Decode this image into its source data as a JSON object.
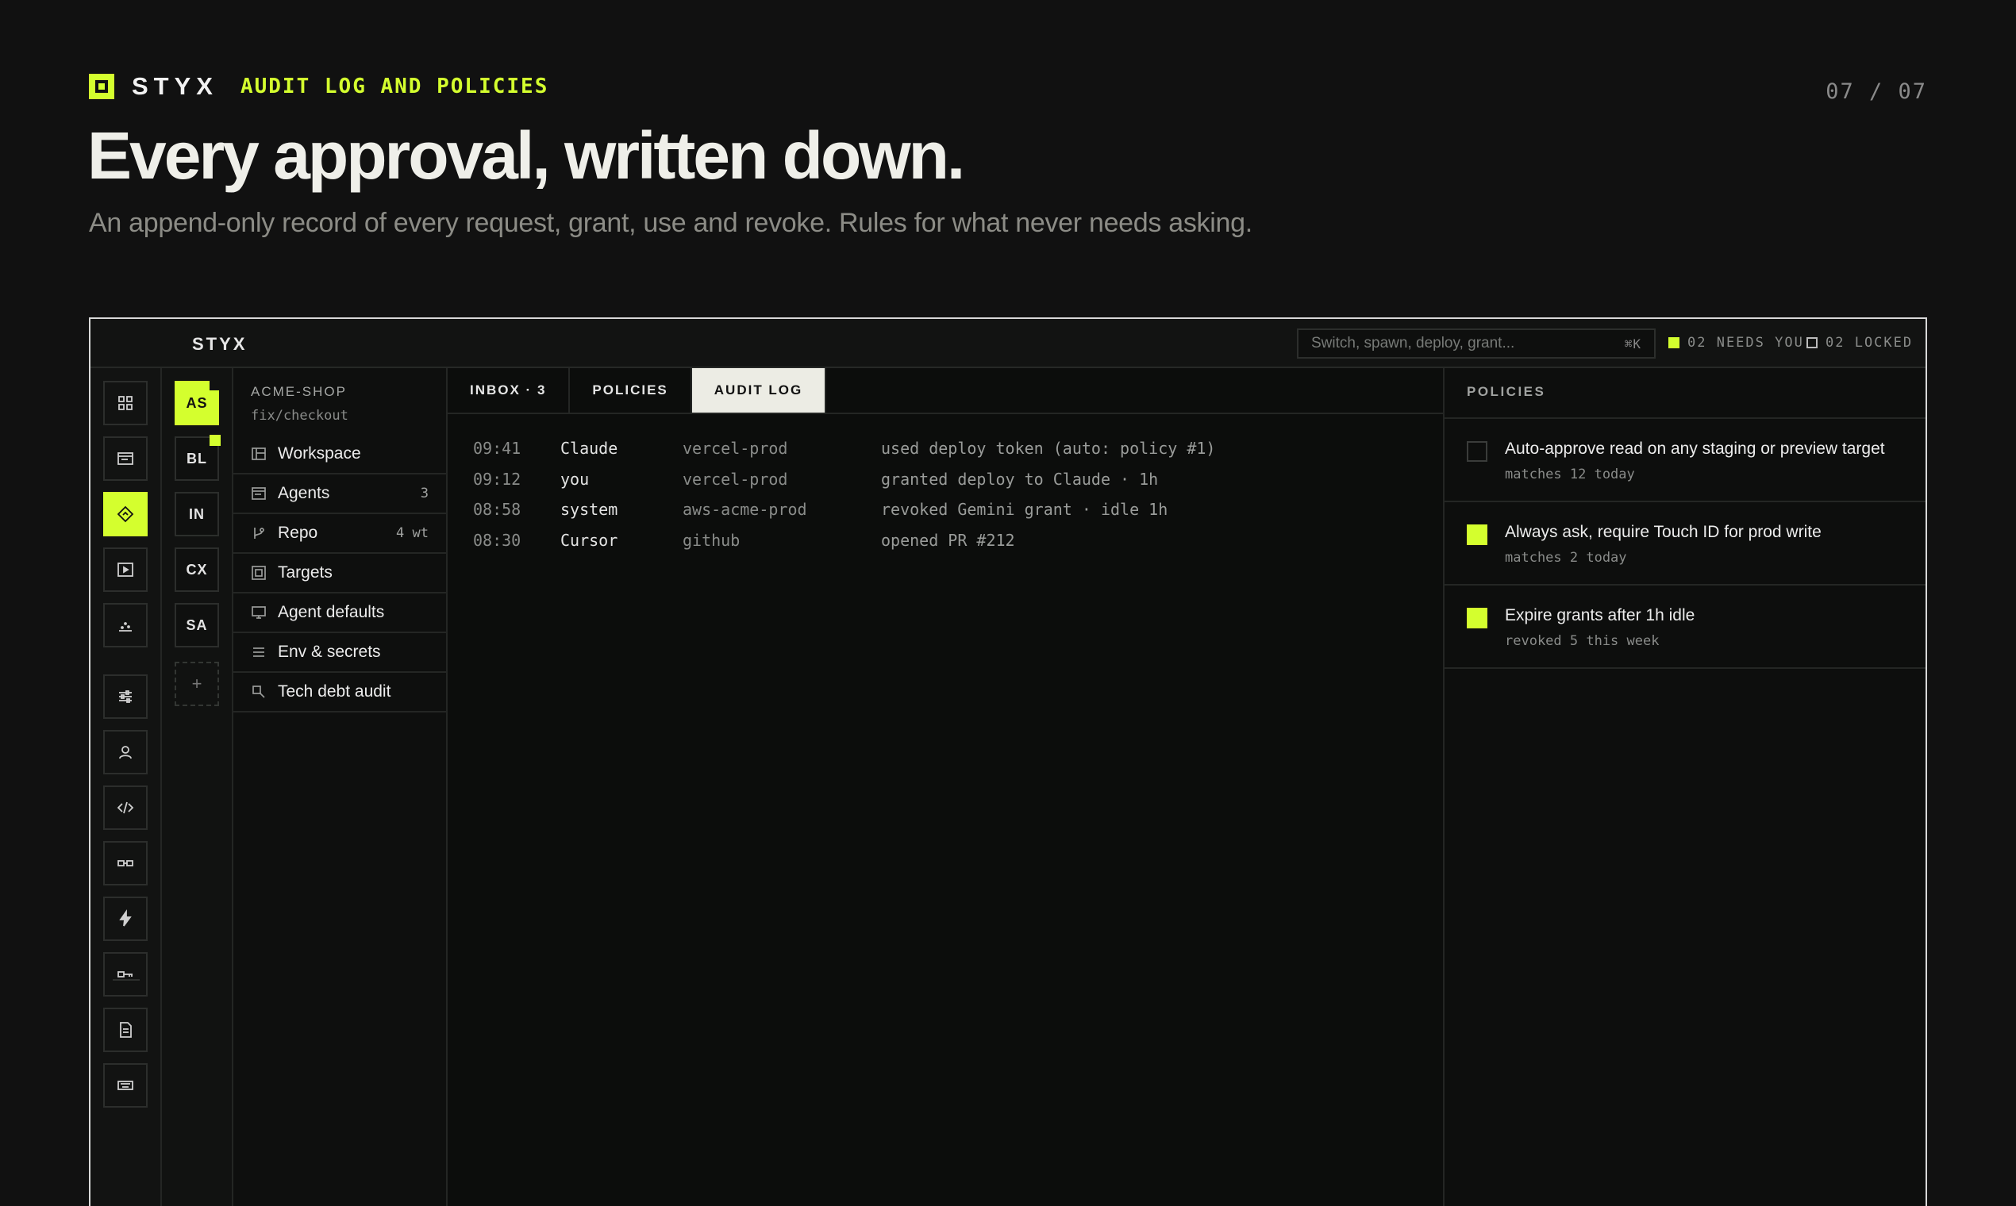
{
  "slide": {
    "brand": "STYX",
    "section": "AUDIT LOG AND POLICIES",
    "page": "07 / 07",
    "headline": "Every approval, written down.",
    "subhead": "An append-only record of every request, grant, use and revoke. Rules for what never needs asking."
  },
  "colors": {
    "accent": "#d4ff2e",
    "background": "#111111"
  },
  "app": {
    "title": "STYX",
    "search": {
      "placeholder": "Switch, spawn, deploy, grant...",
      "shortcut": "⌘K"
    },
    "status": {
      "needs_you": "02 NEEDS YOU",
      "locked": "02 LOCKED"
    },
    "rail": [
      {
        "icon": "grid-icon"
      },
      {
        "icon": "browser-window-icon"
      },
      {
        "icon": "diamond-route-icon",
        "active": true
      },
      {
        "icon": "play-icon"
      },
      {
        "icon": "chart-icon"
      },
      {
        "icon": "sliders-icon"
      },
      {
        "icon": "user-icon"
      },
      {
        "icon": "code-icon"
      },
      {
        "icon": "link-icon"
      },
      {
        "icon": "bolt-icon"
      },
      {
        "icon": "key-icon"
      },
      {
        "icon": "document-icon"
      },
      {
        "icon": "keyboard-icon"
      }
    ],
    "projects": [
      {
        "label": "AS",
        "active": true
      },
      {
        "label": "BL",
        "badge": true
      },
      {
        "label": "IN"
      },
      {
        "label": "CX"
      },
      {
        "label": "SA"
      }
    ],
    "project_add": "+",
    "nav": {
      "org": "ACME-SHOP",
      "branch": "fix/checkout",
      "items": [
        {
          "label": "Workspace",
          "count": "",
          "icon": "layout-icon"
        },
        {
          "label": "Agents",
          "count": "3",
          "icon": "browser-window-icon"
        },
        {
          "label": "Repo",
          "count": "4 wt",
          "icon": "git-branch-icon"
        },
        {
          "label": "Targets",
          "count": "",
          "icon": "target-icon"
        },
        {
          "label": "Agent defaults",
          "count": "",
          "icon": "monitor-icon"
        },
        {
          "label": "Env & secrets",
          "count": "",
          "icon": "list-icon"
        },
        {
          "label": "Tech debt audit",
          "count": "",
          "icon": "search-doc-icon"
        }
      ]
    },
    "tabs": [
      {
        "label": "INBOX · 3",
        "active": false
      },
      {
        "label": "POLICIES",
        "active": false
      },
      {
        "label": "AUDIT LOG",
        "active": true
      }
    ],
    "audit_log": [
      {
        "time": "09:41",
        "actor": "Claude",
        "target": "vercel-prod",
        "message": "used deploy token (auto: policy #1)"
      },
      {
        "time": "09:12",
        "actor": "you",
        "target": "vercel-prod",
        "message": "granted deploy to Claude · 1h"
      },
      {
        "time": "08:58",
        "actor": "system",
        "target": "aws-acme-prod",
        "message": "revoked Gemini grant · idle 1h"
      },
      {
        "time": "08:30",
        "actor": "Cursor",
        "target": "github",
        "message": "opened PR #212"
      }
    ],
    "policies": {
      "title": "POLICIES",
      "items": [
        {
          "title": "Auto-approve read on any staging or preview target",
          "detail": "matches 12 today",
          "enabled": false
        },
        {
          "title": "Always ask, require Touch ID for prod write",
          "detail": "matches 2 today",
          "enabled": true
        },
        {
          "title": "Expire grants after 1h idle",
          "detail": "revoked 5 this week",
          "enabled": true
        }
      ]
    }
  }
}
